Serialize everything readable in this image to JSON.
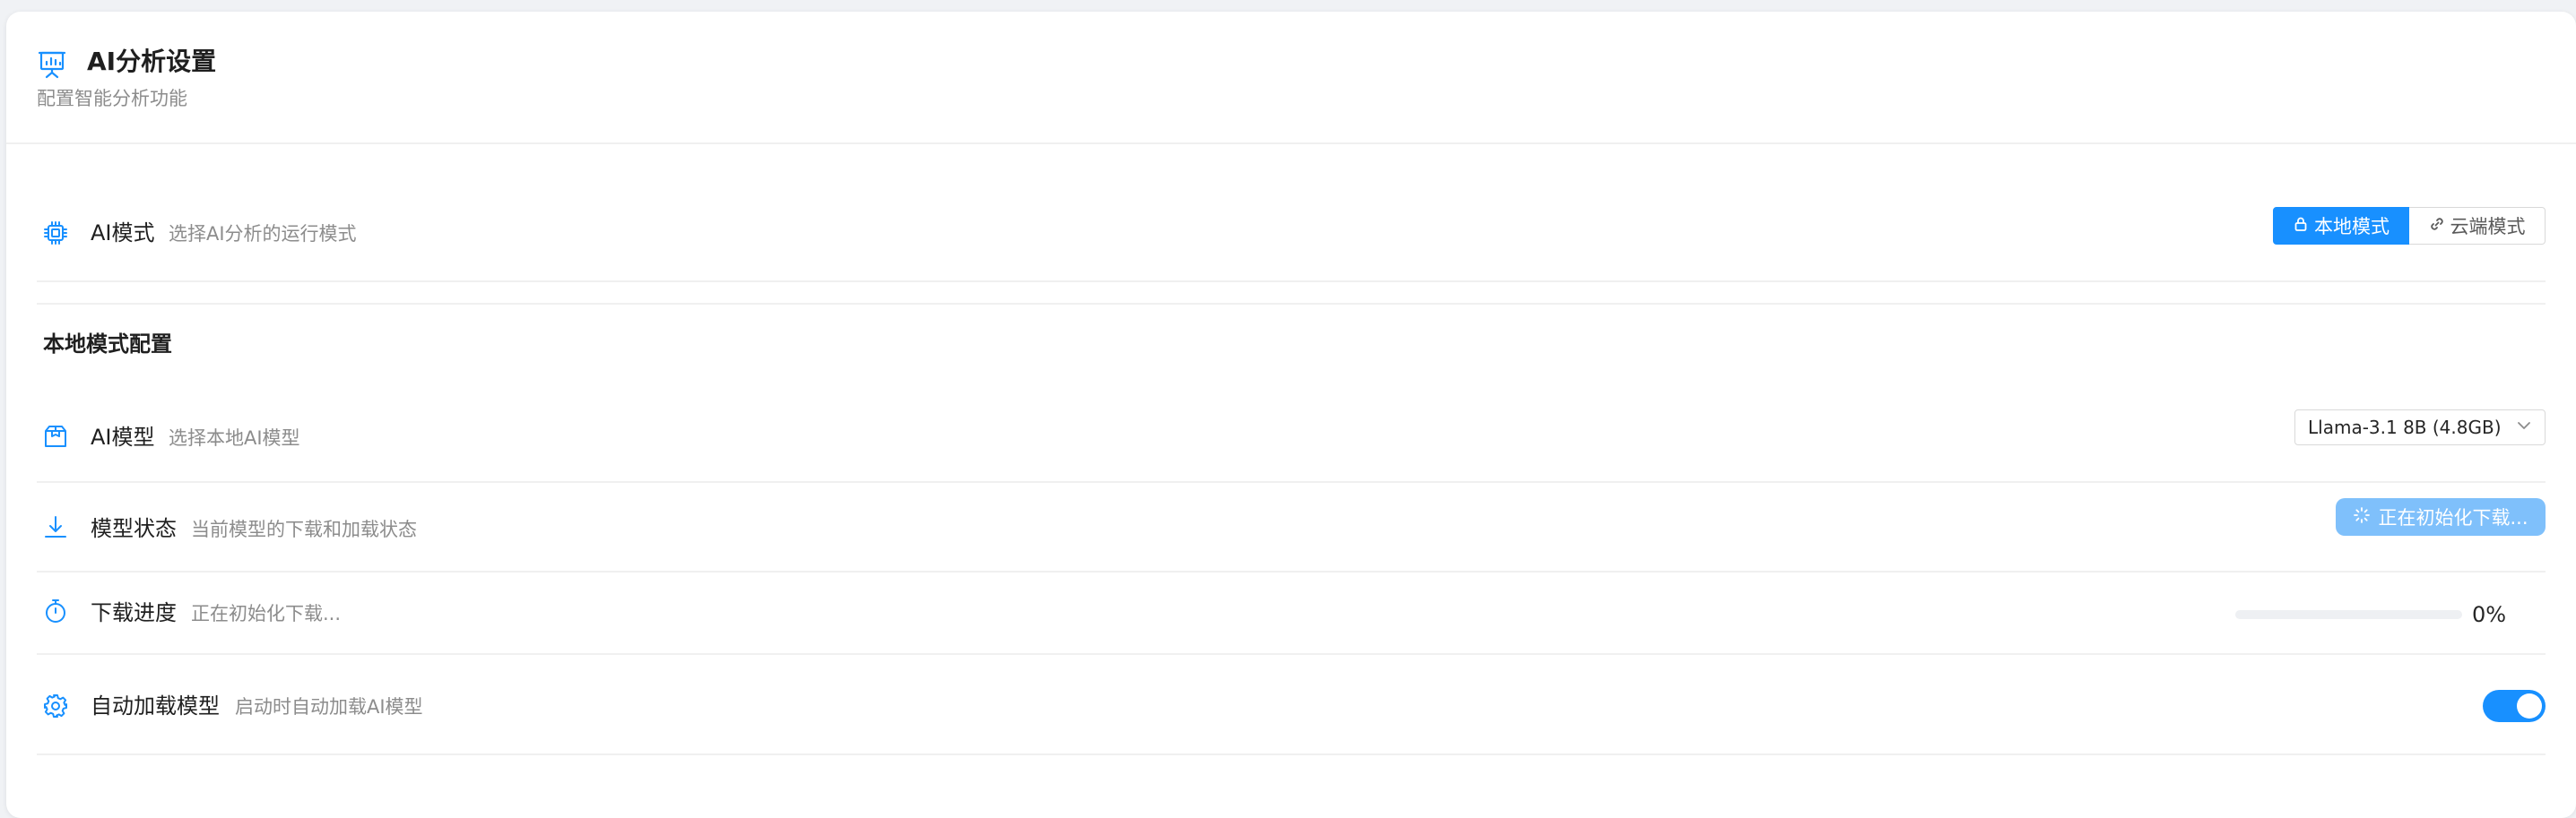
{
  "header": {
    "title": "AI分析设置",
    "subtitle": "配置智能分析功能",
    "icon": "presentation-chart-icon"
  },
  "ai_mode": {
    "label": "AI模式",
    "description": "选择AI分析的运行模式",
    "icon": "chip-icon",
    "options": [
      {
        "label": "本地模式",
        "icon": "lock-icon",
        "selected": true
      },
      {
        "label": "云端模式",
        "icon": "link-icon",
        "selected": false
      }
    ]
  },
  "local_section": {
    "title": "本地模式配置"
  },
  "ai_model": {
    "label": "AI模型",
    "description": "选择本地AI模型",
    "icon": "package-icon",
    "selected_value": "Llama-3.1 8B (4.8GB)"
  },
  "model_status": {
    "label": "模型状态",
    "description": "当前模型的下载和加载状态",
    "icon": "download-icon",
    "status_label": "正在初始化下载..."
  },
  "download_progress": {
    "label": "下载进度",
    "description": "正在初始化下载...",
    "icon": "timer-icon",
    "percent": 0,
    "percent_text": "0%"
  },
  "auto_load": {
    "label": "自动加载模型",
    "description": "启动时自动加载AI模型",
    "icon": "gear-icon",
    "enabled": true
  },
  "colors": {
    "accent": "#1890ff",
    "accent_disabled": "#7fc0fb",
    "text_primary": "#1f1f1f",
    "text_secondary": "#8c8c8c",
    "border": "#d9d9d9"
  }
}
